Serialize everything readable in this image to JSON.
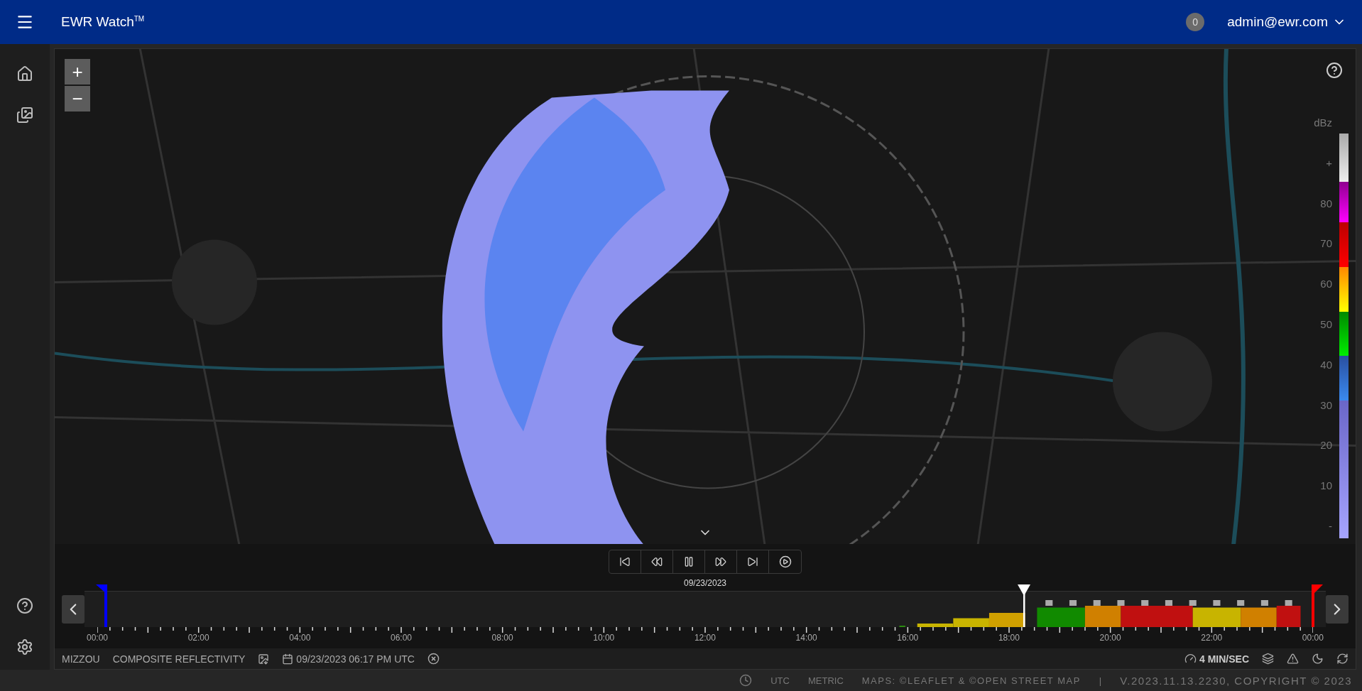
{
  "header": {
    "title": "EWR Watch$^{TM}$",
    "notifications": "0",
    "user": "admin@ewr.com"
  },
  "map": {
    "zoom_in": "+",
    "zoom_out": "−",
    "legend": {
      "unit": "dBz",
      "top_mark": "+",
      "ticks": [
        "80",
        "70",
        "60",
        "50",
        "40",
        "30",
        "20",
        "10"
      ],
      "bottom_mark": "-"
    }
  },
  "timeline": {
    "date": "09/23/2023",
    "hours": [
      "00:00",
      "02:00",
      "04:00",
      "06:00",
      "08:00",
      "10:00",
      "12:00",
      "14:00",
      "16:00",
      "18:00",
      "20:00",
      "22:00",
      "00:00"
    ],
    "playhead": {
      "level": 0.762
    }
  },
  "info": {
    "station": "MIZZOU",
    "product": "COMPOSITE REFLECTIVITY",
    "datetime": "09/23/2023 06:17 PM UTC",
    "speed": "4 MIN/SEC"
  },
  "footer": {
    "timezone": "UTC",
    "units": "METRIC",
    "attribution": "MAPS: ©LEAFLET & ©OPEN STREET MAP",
    "separator": "|",
    "version": "V.2023.11.13.2230, COPYRIGHT © 2023"
  }
}
